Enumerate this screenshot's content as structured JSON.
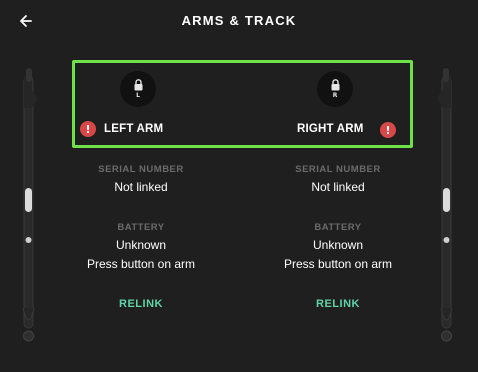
{
  "header": {
    "title": "ARMS & TRACK",
    "back_icon": "arrow-left-icon"
  },
  "arms": {
    "left": {
      "lock_letter": "L",
      "label": "LEFT ARM",
      "warning_symbol": "!",
      "serial_label": "SERIAL NUMBER",
      "serial_value": "Not linked",
      "battery_label": "BATTERY",
      "battery_value": "Unknown",
      "battery_hint": "Press button on arm",
      "relink_label": "RELINK"
    },
    "right": {
      "lock_letter": "R",
      "label": "RIGHT ARM",
      "warning_symbol": "!",
      "serial_label": "SERIAL NUMBER",
      "serial_value": "Not linked",
      "battery_label": "BATTERY",
      "battery_value": "Unknown",
      "battery_hint": "Press button on arm",
      "relink_label": "RELINK"
    }
  },
  "colors": {
    "background": "#1f1f1f",
    "highlight": "#6ee04a",
    "warning": "#d94848",
    "relink": "#5fd4a6",
    "muted_label": "#6b6b6b"
  }
}
